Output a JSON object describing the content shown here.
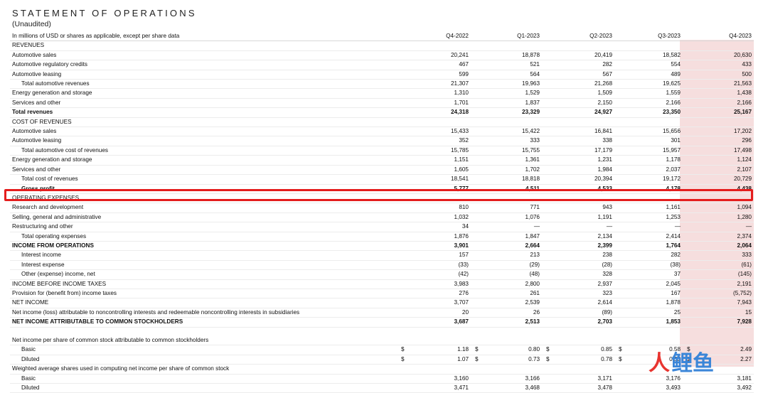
{
  "title": "STATEMENT OF OPERATIONS",
  "subtitle": "(Unaudited)",
  "header": [
    "In millions of USD or shares as applicable, except per share data",
    "Q4-2022",
    "Q1-2023",
    "Q2-2023",
    "Q3-2023",
    "Q4-2023"
  ],
  "rows": [
    {
      "label": "REVENUES",
      "vals": [
        "",
        "",
        "",
        "",
        ""
      ]
    },
    {
      "label": "Automotive sales",
      "vals": [
        "20,241",
        "18,878",
        "20,419",
        "18,582",
        "20,630"
      ]
    },
    {
      "label": "Automotive regulatory credits",
      "vals": [
        "467",
        "521",
        "282",
        "554",
        "433"
      ]
    },
    {
      "label": "Automotive leasing",
      "vals": [
        "599",
        "564",
        "567",
        "489",
        "500"
      ]
    },
    {
      "label": "Total automotive revenues",
      "vals": [
        "21,307",
        "19,963",
        "21,268",
        "19,625",
        "21,563"
      ]
    },
    {
      "label": "Energy generation and storage",
      "vals": [
        "1,310",
        "1,529",
        "1,509",
        "1,559",
        "1,438"
      ]
    },
    {
      "label": "Services and other",
      "vals": [
        "1,701",
        "1,837",
        "2,150",
        "2,166",
        "2,166"
      ]
    },
    {
      "label": "Total revenues",
      "vals": [
        "24,318",
        "23,329",
        "24,927",
        "23,350",
        "25,167"
      ]
    },
    {
      "label": "COST OF REVENUES",
      "vals": [
        "",
        "",
        "",
        "",
        ""
      ]
    },
    {
      "label": "Automotive sales",
      "vals": [
        "15,433",
        "15,422",
        "16,841",
        "15,656",
        "17,202"
      ]
    },
    {
      "label": "Automotive leasing",
      "vals": [
        "352",
        "333",
        "338",
        "301",
        "296"
      ]
    },
    {
      "label": "Total automotive cost of revenues",
      "vals": [
        "15,785",
        "15,755",
        "17,179",
        "15,957",
        "17,498"
      ]
    },
    {
      "label": "Energy generation and storage",
      "vals": [
        "1,151",
        "1,361",
        "1,231",
        "1,178",
        "1,124"
      ]
    },
    {
      "label": "Services and other",
      "vals": [
        "1,605",
        "1,702",
        "1,984",
        "2,037",
        "2,107"
      ]
    },
    {
      "label": "Total cost of revenues",
      "vals": [
        "18,541",
        "18,818",
        "20,394",
        "19,172",
        "20,729"
      ]
    },
    {
      "label": "Gross profit",
      "vals": [
        "5,777",
        "4,511",
        "4,533",
        "4,178",
        "4,438"
      ]
    },
    {
      "label": "OPERATING EXPENSES",
      "vals": [
        "",
        "",
        "",
        "",
        ""
      ]
    },
    {
      "label": "Research and development",
      "vals": [
        "810",
        "771",
        "943",
        "1,161",
        "1,094"
      ]
    },
    {
      "label": "Selling, general and administrative",
      "vals": [
        "1,032",
        "1,076",
        "1,191",
        "1,253",
        "1,280"
      ]
    },
    {
      "label": "Restructuring and other",
      "vals": [
        "34",
        "—",
        "—",
        "—",
        "—"
      ]
    },
    {
      "label": "Total operating expenses",
      "vals": [
        "1,876",
        "1,847",
        "2,134",
        "2,414",
        "2,374"
      ]
    },
    {
      "label": "INCOME FROM OPERATIONS",
      "vals": [
        "3,901",
        "2,664",
        "2,399",
        "1,764",
        "2,064"
      ]
    },
    {
      "label": "Interest income",
      "vals": [
        "157",
        "213",
        "238",
        "282",
        "333"
      ]
    },
    {
      "label": "Interest expense",
      "vals": [
        "(33)",
        "(29)",
        "(28)",
        "(38)",
        "(61)"
      ]
    },
    {
      "label": "Other (expense) income, net",
      "vals": [
        "(42)",
        "(48)",
        "328",
        "37",
        "(145)"
      ]
    },
    {
      "label": "INCOME BEFORE INCOME TAXES",
      "vals": [
        "3,983",
        "2,800",
        "2,937",
        "2,045",
        "2,191"
      ]
    },
    {
      "label": "Provision for (benefit from) income taxes",
      "vals": [
        "276",
        "261",
        "323",
        "167",
        "(5,752)"
      ]
    },
    {
      "label": "NET INCOME",
      "vals": [
        "3,707",
        "2,539",
        "2,614",
        "1,878",
        "7,943"
      ]
    },
    {
      "label": "Net income (loss) attributable to noncontrolling interests and redeemable noncontrolling interests in subsidiaries",
      "vals": [
        "20",
        "26",
        "(89)",
        "25",
        "15"
      ]
    },
    {
      "label": "NET INCOME ATTRIBUTABLE TO COMMON STOCKHOLDERS",
      "vals": [
        "3,687",
        "2,513",
        "2,703",
        "1,853",
        "7,928"
      ]
    },
    {
      "label": "",
      "vals": [
        "",
        "",
        "",
        "",
        ""
      ]
    },
    {
      "label": "Net income per share of common stock attributable to common stockholders",
      "vals": [
        "",
        "",
        "",
        "",
        ""
      ]
    },
    {
      "label": "Basic",
      "vals": [
        "1.18",
        "0.80",
        "0.85",
        "0.58",
        "2.49"
      ]
    },
    {
      "label": "Diluted",
      "vals": [
        "1.07",
        "0.73",
        "0.78",
        "0.53",
        "2.27"
      ]
    },
    {
      "label": "Weighted average shares used in computing net income per share of common stock",
      "vals": [
        "",
        "",
        "",
        "",
        ""
      ]
    },
    {
      "label": "Basic",
      "vals": [
        "3,160",
        "3,166",
        "3,171",
        "3,176",
        "3,181"
      ]
    },
    {
      "label": "Diluted",
      "vals": [
        "3,471",
        "3,468",
        "3,478",
        "3,493",
        "3,492"
      ]
    }
  ],
  "currency_symbol": "$",
  "watermark": {
    "a": "人",
    "b": "鲤鱼"
  },
  "highlight": {
    "row": "Research and development",
    "box_color": "#e41d1d",
    "column_shade": "#f6dede"
  }
}
